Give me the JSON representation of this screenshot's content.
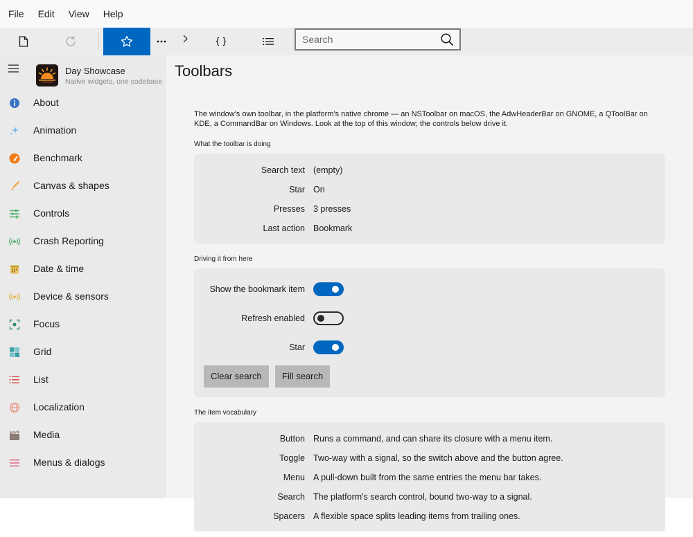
{
  "menubar": {
    "items": [
      "File",
      "Edit",
      "View",
      "Help"
    ]
  },
  "toolbar": {
    "search_placeholder": "Search"
  },
  "sidebar": {
    "app_name": "Day Showcase",
    "app_tagline": "Native widgets, one codebase",
    "items": [
      {
        "label": "About",
        "icon": "info-icon",
        "color": "#3a73c5"
      },
      {
        "label": "Animation",
        "icon": "sparkle-icon",
        "color": "#79b7ea"
      },
      {
        "label": "Benchmark",
        "icon": "gauge-icon",
        "color": "#f07c1c"
      },
      {
        "label": "Canvas & shapes",
        "icon": "brush-icon",
        "color": "#efa53d"
      },
      {
        "label": "Controls",
        "icon": "sliders-icon",
        "color": "#3fa55b"
      },
      {
        "label": "Crash Reporting",
        "icon": "broadcast-icon",
        "color": "#3fa55b"
      },
      {
        "label": "Date & time",
        "icon": "calendar-icon",
        "color": "#c9a227"
      },
      {
        "label": "Device & sensors",
        "icon": "sensor-icon",
        "color": "#e0b040"
      },
      {
        "label": "Focus",
        "icon": "focus-icon",
        "color": "#2f8a6a"
      },
      {
        "label": "Grid",
        "icon": "grid-icon",
        "color": "#3aa0a8"
      },
      {
        "label": "List",
        "icon": "list-icon",
        "color": "#d94a4a"
      },
      {
        "label": "Localization",
        "icon": "globe-icon",
        "color": "#e88b7a"
      },
      {
        "label": "Media",
        "icon": "clapper-icon",
        "color": "#8a7c74"
      },
      {
        "label": "Menus & dialogs",
        "icon": "menu-icon",
        "color": "#e0607e"
      }
    ]
  },
  "main": {
    "title": "Toolbars",
    "intro": "The window's own toolbar, in the platform's native chrome — an NSToolbar on macOS, the AdwHeaderBar on GNOME, a QToolBar on KDE, a CommandBar on Windows. Look at the top of this window; the controls below drive it.",
    "status": {
      "heading": "What the toolbar is doing",
      "rows": [
        {
          "label": "Search text",
          "value": "(empty)"
        },
        {
          "label": "Star",
          "value": "On"
        },
        {
          "label": "Presses",
          "value": "3 presses"
        },
        {
          "label": "Last action",
          "value": "Bookmark"
        }
      ]
    },
    "controls": {
      "heading": "Driving it from here",
      "toggles": [
        {
          "label": "Show the bookmark item",
          "on": true
        },
        {
          "label": "Refresh enabled",
          "on": false
        },
        {
          "label": "Star",
          "on": true
        }
      ],
      "buttons": [
        "Clear search",
        "Fill search"
      ]
    },
    "vocabulary": {
      "heading": "The item vocabulary",
      "rows": [
        {
          "label": "Button",
          "value": "Runs a command, and can share its closure with a menu item."
        },
        {
          "label": "Toggle",
          "value": "Two-way with a signal, so the switch above and the button agree."
        },
        {
          "label": "Menu",
          "value": "A pull-down built from the same entries the menu bar takes."
        },
        {
          "label": "Search",
          "value": "The platform's search control, bound two-way to a signal."
        },
        {
          "label": "Spacers",
          "value": "A flexible space splits leading items from trailing ones."
        }
      ]
    }
  },
  "colors": {
    "accent": "#0067c0",
    "content_bg": "#f3f3f3",
    "sidebar_bg": "#eaeaea",
    "card_bg": "#e9e9e9"
  }
}
